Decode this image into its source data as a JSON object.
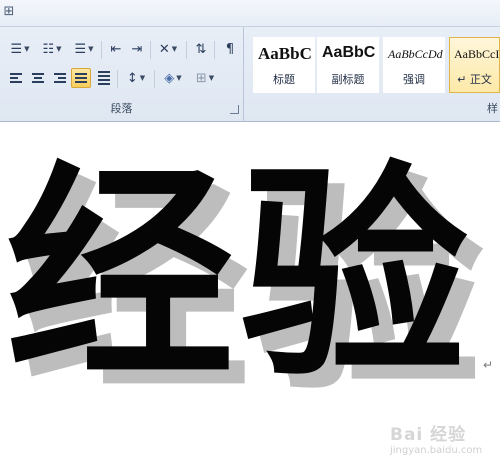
{
  "ribbon": {
    "paragraph_group": {
      "label": "段落",
      "buttons": [
        {
          "icon": "bullets-icon",
          "label": "Bullets"
        },
        {
          "icon": "numbering-icon",
          "label": "Numbering"
        },
        {
          "icon": "multilevel-list-icon",
          "label": "Multilevel List"
        },
        {
          "icon": "decrease-indent-icon",
          "label": "Decrease Indent"
        },
        {
          "icon": "increase-indent-icon",
          "label": "Increase Indent"
        },
        {
          "icon": "chinese-layout-icon",
          "label": "Chinese Layout"
        },
        {
          "icon": "sort-icon",
          "label": "Sort"
        },
        {
          "icon": "show-hide-marks-icon",
          "label": "Show/Hide"
        },
        {
          "icon": "align-left-icon",
          "label": "Align Left"
        },
        {
          "icon": "center-icon",
          "label": "Center"
        },
        {
          "icon": "align-right-icon",
          "label": "Align Right"
        },
        {
          "icon": "justify-icon",
          "label": "Justify",
          "active": true
        },
        {
          "icon": "distributed-icon",
          "label": "Distributed"
        },
        {
          "icon": "line-spacing-icon",
          "label": "Line Spacing"
        },
        {
          "icon": "shading-icon",
          "label": "Shading"
        },
        {
          "icon": "borders-icon",
          "label": "Borders"
        }
      ]
    },
    "styles_group": {
      "label": "样",
      "styles": [
        {
          "sample": "AaBbC",
          "name": "标题"
        },
        {
          "sample": "AaBbC",
          "name": "副标题"
        },
        {
          "sample": "AaBbCcDd",
          "name": "强调"
        },
        {
          "sample": "AaBbCcI",
          "name": "↵ 正文",
          "selected": true
        }
      ]
    },
    "window_glyph": "⊞",
    "colors": {
      "ribbon_bg": "#dfe7f2",
      "selected_style": "#fde9a8",
      "accent_border": "#e0b44a"
    }
  },
  "document": {
    "text": "经验",
    "paragraph_mark": "↵",
    "text_color": "#050505",
    "shadow_color": "#bdbdbd"
  },
  "watermark": {
    "main": "Bai  经验",
    "sub": "jingyan.baidu.com"
  }
}
